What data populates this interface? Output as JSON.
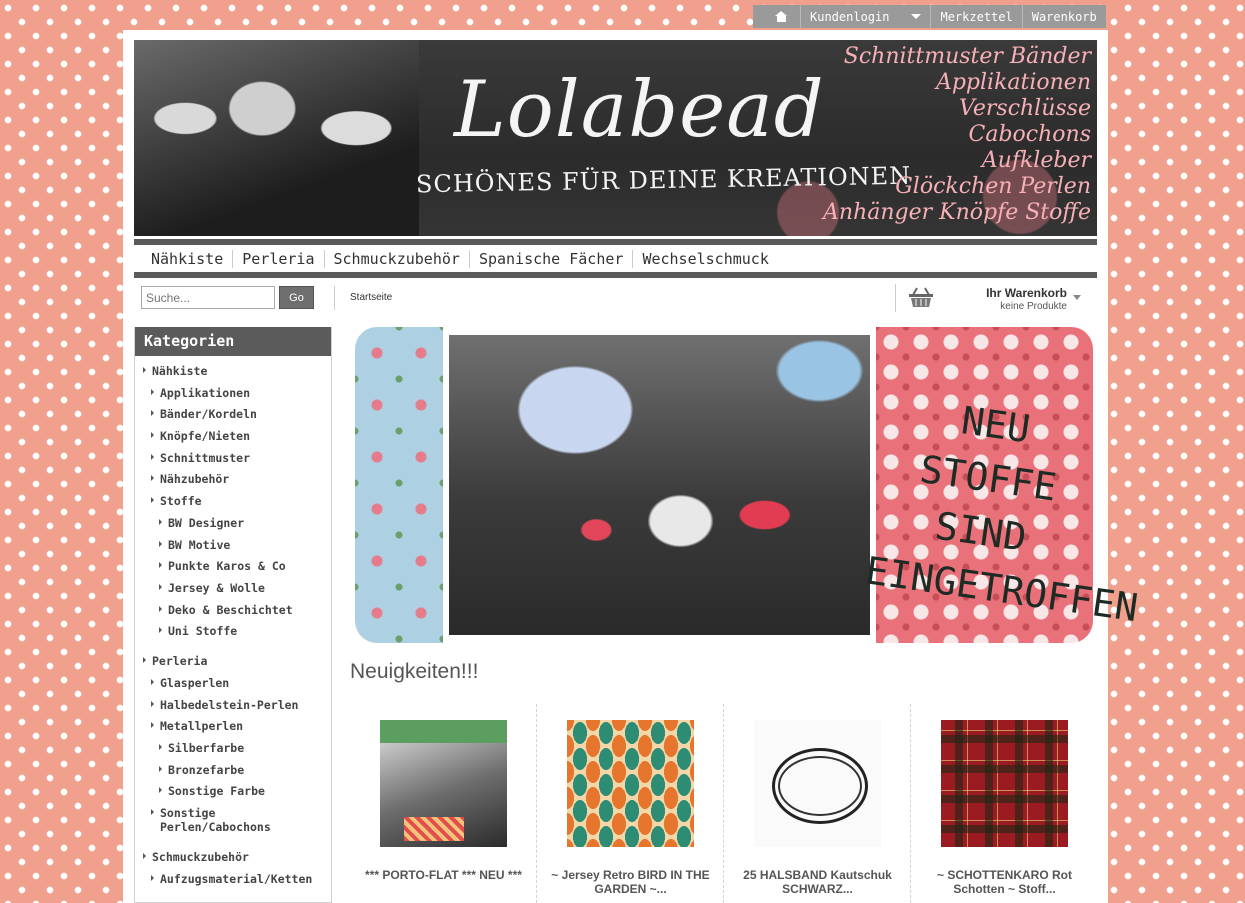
{
  "topbar": {
    "login_label": "Kundenlogin",
    "wishlist_label": "Merkzettel",
    "cart_label": "Warenkorb"
  },
  "banner": {
    "logo_text": "Lolabead",
    "tagline": "SCHÖNES FÜR DEINE KREATIONEN",
    "words": [
      "Schnittmuster Bänder",
      "Applikationen",
      "Verschlüsse",
      "Cabochons",
      "Aufkleber",
      "Glöckchen Perlen",
      "Anhänger Knöpfe Stoffe"
    ]
  },
  "mainnav": {
    "items": [
      "Nähkiste",
      "Perleria",
      "Schmuckzubehör",
      "Spanische Fächer",
      "Wechselschmuck"
    ]
  },
  "search": {
    "placeholder": "Suche...",
    "button_label": "Go"
  },
  "breadcrumb": {
    "home": "Startseite"
  },
  "cart": {
    "title": "Ihr Warenkorb",
    "status": "keine Produkte"
  },
  "sidebar": {
    "title": "Kategorien",
    "items": [
      {
        "label": "Nähkiste",
        "level": 0
      },
      {
        "label": "Applikationen",
        "level": 1
      },
      {
        "label": "Bänder/Kordeln",
        "level": 1
      },
      {
        "label": "Knöpfe/Nieten",
        "level": 1
      },
      {
        "label": "Schnittmuster",
        "level": 1
      },
      {
        "label": "Nähzubehör",
        "level": 1
      },
      {
        "label": "Stoffe",
        "level": 1
      },
      {
        "label": "BW Designer",
        "level": 2
      },
      {
        "label": "BW Motive",
        "level": 2
      },
      {
        "label": "Punkte Karos & Co",
        "level": 2
      },
      {
        "label": "Jersey & Wolle",
        "level": 2
      },
      {
        "label": "Deko & Beschichtet",
        "level": 2
      },
      {
        "label": "Uni Stoffe",
        "level": 2
      },
      {
        "label": "Perleria",
        "level": 0
      },
      {
        "label": "Glasperlen",
        "level": 1
      },
      {
        "label": "Halbedelstein-Perlen",
        "level": 1
      },
      {
        "label": "Metallperlen",
        "level": 1
      },
      {
        "label": "Silberfarbe",
        "level": 2
      },
      {
        "label": "Bronzefarbe",
        "level": 2
      },
      {
        "label": "Sonstige Farbe",
        "level": 2
      },
      {
        "label": "Sonstige Perlen/Cabochons",
        "level": 1
      },
      {
        "label": "Schmuckzubehör",
        "level": 0
      },
      {
        "label": "Aufzugsmaterial/Ketten",
        "level": 1
      }
    ]
  },
  "hero": {
    "text_lines": [
      "NEU STOFFE",
      "SIND",
      "EINGETROFFEN"
    ]
  },
  "news": {
    "title": "Neuigkeiten!!!",
    "products": [
      {
        "name": "*** PORTO-FLAT *** NEU ***"
      },
      {
        "name": "~ Jersey Retro BIRD IN THE GARDEN ~..."
      },
      {
        "name": "25 HALSBAND Kautschuk SCHWARZ..."
      },
      {
        "name": "~ SCHOTTENKARO Rot Schotten ~ Stoff..."
      }
    ]
  },
  "colors": {
    "background": "#f0a08c",
    "nav_dark": "#5b5b5b",
    "topbar": "#9a9a9a"
  }
}
